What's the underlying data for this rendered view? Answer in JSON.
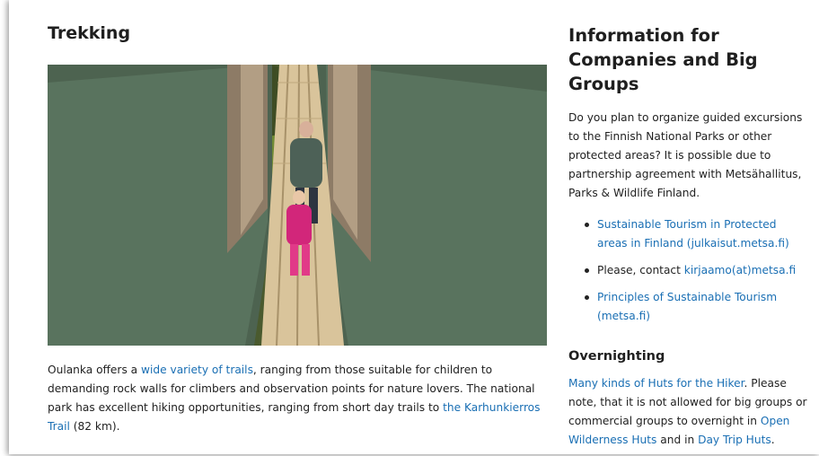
{
  "trekking": {
    "heading": "Trekking",
    "photo_icon": "suspension-bridge-photo",
    "text_1": "Oulanka offers a ",
    "link_trails": "wide variety of trails",
    "text_2": ", ranging from those suitable for children to demanding rock walls for climbers and observation points for nature lovers. The national park has excellent hiking opportunities, ranging from short day trails to ",
    "link_karhunkierros": "the Karhunkierros Trail",
    "text_3": " (82 km)."
  },
  "info": {
    "heading": "Information for Companies and Big Groups",
    "intro": "Do you plan to organize guided excursions to the Finnish National Parks or other protected areas? It is possible due to partnership agreement with Metsähallitus, Parks & Wildlife Finland.",
    "links": {
      "item1": "Sustainable Tourism in Protected areas in Finland (julkaisut.metsa.fi)",
      "item2_text": "Please, contact ",
      "item2_link": "kirjaamo(at)metsa.fi",
      "item3": "Principles of Sustainable Tourism (metsa.fi)"
    }
  },
  "overnighting": {
    "heading": "Overnighting",
    "link_huts": "Many kinds of Huts for the Hiker",
    "text_1": ". Please note, that it is not allowed for big groups or commercial groups to overnight in ",
    "link_open": "Open Wilderness Huts",
    "text_2": " and in ",
    "link_daytrip": "Day Trip Huts",
    "text_3": "."
  },
  "colors": {
    "link": "#1a6fb4",
    "text": "#222222"
  }
}
